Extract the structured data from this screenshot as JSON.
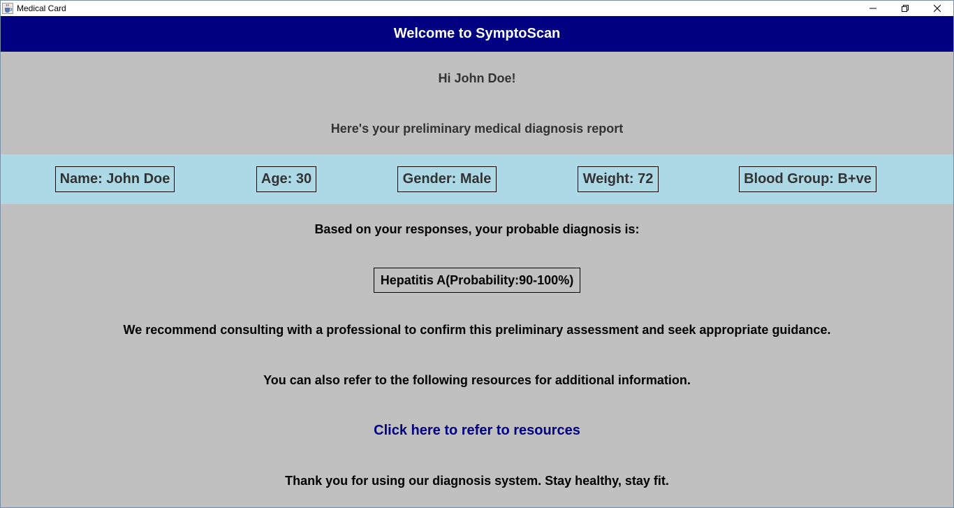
{
  "window": {
    "title": "Medical Card",
    "icon": "java-cup-icon",
    "controls": [
      "minimize-icon",
      "restore-icon",
      "close-icon"
    ]
  },
  "header": {
    "title": "Welcome to SymptoScan",
    "background": "#000080"
  },
  "greeting": "Hi John Doe!",
  "intro": "Here's your preliminary medical diagnosis report",
  "patient": {
    "band_color": "#add8e6",
    "name": "Name: John Doe",
    "age": "Age: 30",
    "gender": "Gender: Male",
    "weight": "Weight: 72",
    "blood_group": "Blood Group: B+ve"
  },
  "diagnosis": {
    "lead": "Based on your responses, your probable diagnosis is:",
    "result": "Hepatitis A(Probability:90-100%)"
  },
  "recommendation": "We recommend consulting with a professional to confirm this preliminary assessment and seek appropriate guidance.",
  "resources": {
    "lead": "You can also refer to the following resources for additional information.",
    "link_text": "Click here to refer to resources",
    "link_color": "#000080"
  },
  "closing": "Thank you for using our diagnosis system. Stay healthy, stay fit."
}
